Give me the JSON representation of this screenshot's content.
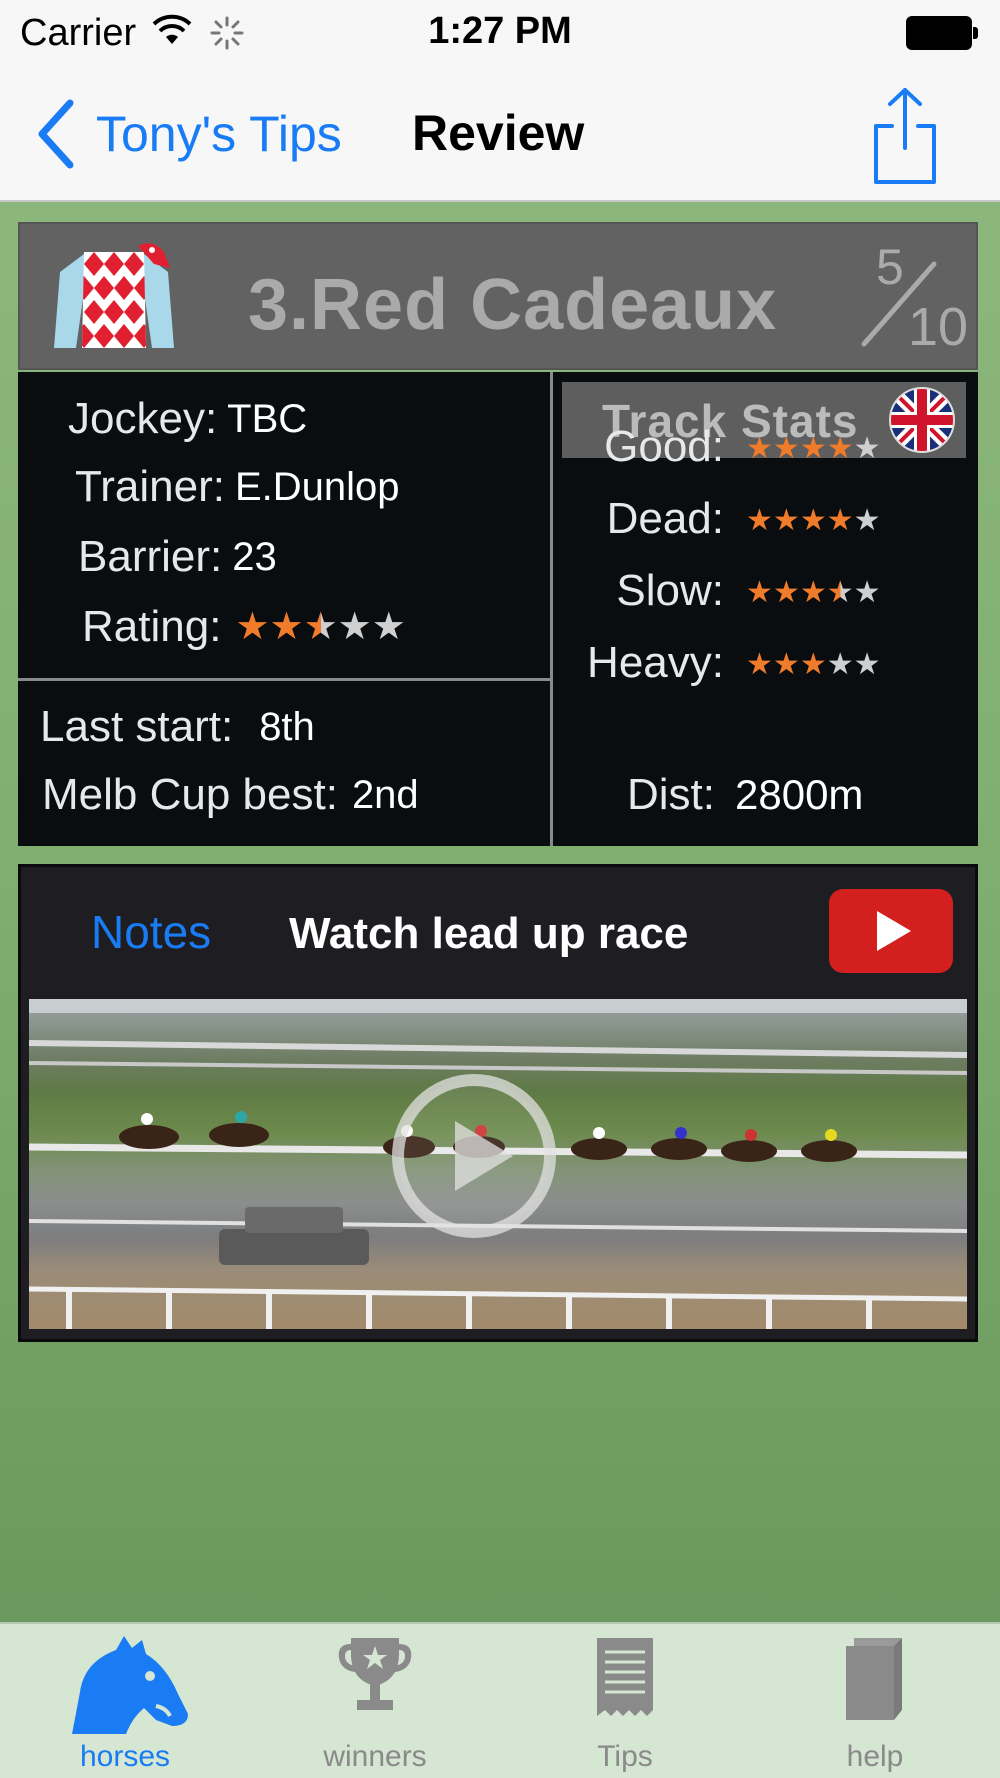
{
  "status_bar": {
    "carrier": "Carrier",
    "time": "1:27 PM"
  },
  "nav": {
    "back_label": "Tony's Tips",
    "title": "Review"
  },
  "horse": {
    "name": "3.Red Cadeaux",
    "odds_numerator": "5",
    "odds_denominator": "10",
    "silks_colors": [
      "#e02030",
      "#ffffff",
      "#a8d8ea"
    ]
  },
  "details": {
    "jockey_label": "Jockey:",
    "jockey": "TBC",
    "trainer_label": "Trainer:",
    "trainer": "E.Dunlop",
    "barrier_label": "Barrier:",
    "barrier": "23",
    "rating_label": "Rating:",
    "rating": 2.5,
    "last_start_label": "Last start:",
    "last_start": "8th",
    "melb_cup_label": "Melb Cup best:",
    "melb_cup": "2nd"
  },
  "track_stats": {
    "title": "Track Stats",
    "flag": "uk-flag-icon",
    "rows": [
      {
        "label": "Good:",
        "stars": 4
      },
      {
        "label": "Dead:",
        "stars": 4
      },
      {
        "label": "Slow:",
        "stars": 3.5
      },
      {
        "label": "Heavy:",
        "stars": 3
      }
    ],
    "dist_label": "Dist:",
    "dist": "2800m"
  },
  "video": {
    "notes_label": "Notes",
    "watch_label": "Watch lead up race"
  },
  "tabs": [
    {
      "label": "horses",
      "icon": "horse-head-icon",
      "active": true
    },
    {
      "label": "winners",
      "icon": "trophy-icon",
      "active": false
    },
    {
      "label": "Tips",
      "icon": "receipt-icon",
      "active": false
    },
    {
      "label": "help",
      "icon": "book-icon",
      "active": false
    }
  ],
  "colors": {
    "accent": "#1a7cf5",
    "star": "#f07b2a",
    "panel": "#0a0d10",
    "header": "#626262"
  }
}
